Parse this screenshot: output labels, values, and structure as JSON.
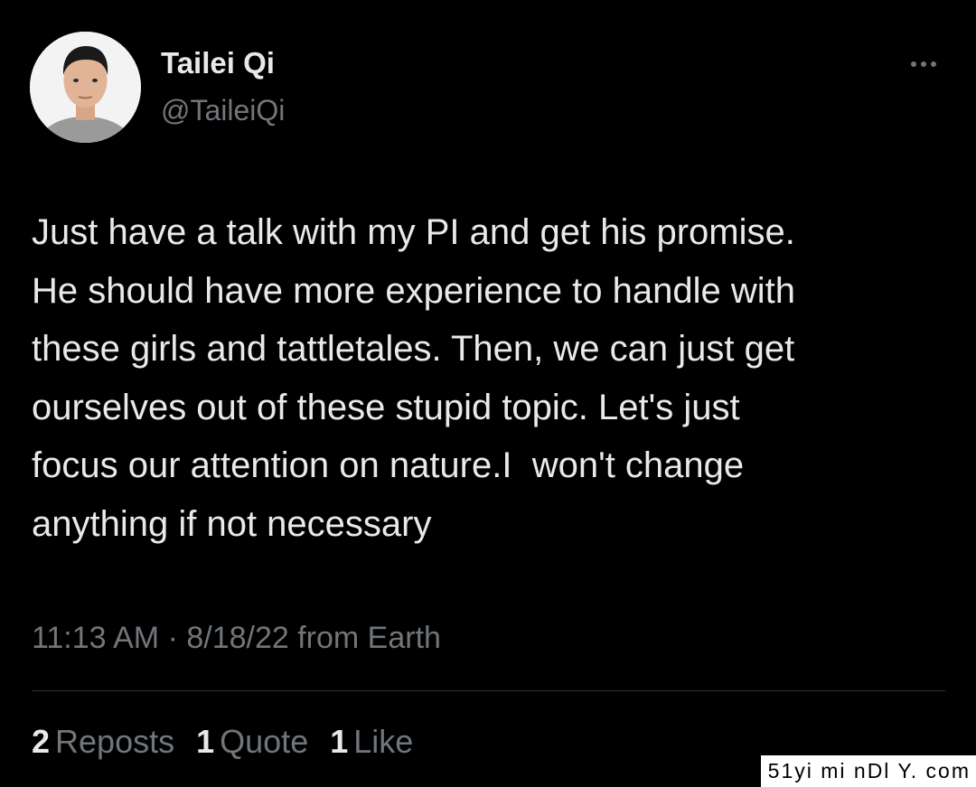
{
  "author": {
    "name": "Tailei Qi",
    "handle": "@TaileiQi",
    "avatar_icon": "user-photo-icon"
  },
  "actions": {
    "more_icon": "more-horizontal-icon"
  },
  "tweet": {
    "text_lines": [
      "Just have a talk with my PI and get his promise.",
      "He should have more experience to handle with",
      "these girls and tattletales. Then, we can just get",
      "ourselves out of these stupid topic. Let's just",
      "focus our attention on nature.I  won't change",
      "anything if not necessary"
    ],
    "meta": "11:13 AM · 8/18/22 from Earth"
  },
  "stats": {
    "reposts": {
      "count": "2",
      "label": "Reposts"
    },
    "quotes": {
      "count": "1",
      "label": "Quote"
    },
    "likes": {
      "count": "1",
      "label": "Like"
    }
  },
  "watermark": "51yi mi nDl Y. com",
  "colors": {
    "background": "#000000",
    "primary_text": "#e7e9ea",
    "secondary_text": "#71767b",
    "divider": "#2f3336"
  }
}
